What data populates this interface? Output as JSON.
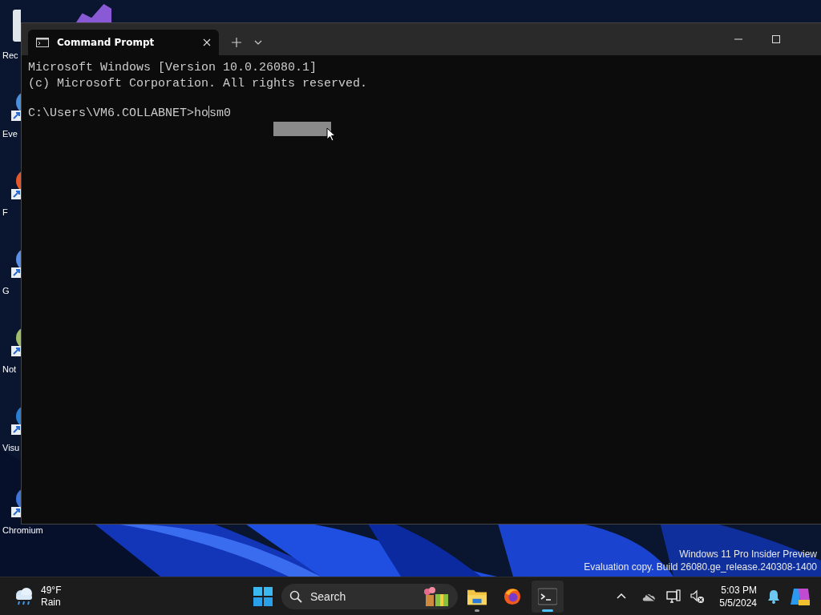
{
  "desktop": {
    "wallpaper": {
      "kind": "picture"
    },
    "icons": [
      {
        "label": "Rec",
        "kind": "recycle-bin"
      },
      {
        "label": "Eve",
        "kind": "shortcut"
      },
      {
        "label": "F",
        "kind": "shortcut"
      },
      {
        "label": "G",
        "kind": "shortcut"
      },
      {
        "label": "Not",
        "kind": "shortcut"
      },
      {
        "label": "Visu",
        "kind": "shortcut"
      },
      {
        "label": "Chromium",
        "kind": "shortcut"
      }
    ],
    "watermark": [
      "Windows 11 Pro Insider Preview",
      "Evaluation copy. Build 26080.ge_release.240308-1400"
    ]
  },
  "window": {
    "tabs": [
      {
        "title": "Command Prompt",
        "selected": true
      }
    ],
    "lines": [
      "Microsoft Windows [Version 10.0.26080.1]",
      "(c) Microsoft Corporation. All rights reserved."
    ],
    "prompt": {
      "path": "C:\\Users\\VM6.COLLABNET>",
      "before_caret": "ho",
      "after_caret": "sm0"
    }
  },
  "taskbar": {
    "weather": {
      "temperature": "49°F",
      "condition": "Rain"
    },
    "search": {
      "placeholder": "Search"
    },
    "apps": [
      {
        "kind": "explorer",
        "running": true,
        "active": false
      },
      {
        "kind": "firefox",
        "running": false,
        "active": false
      },
      {
        "kind": "terminal",
        "running": true,
        "active": true
      }
    ],
    "clock": {
      "time": "5:03 PM",
      "date": "5/5/2024"
    }
  }
}
